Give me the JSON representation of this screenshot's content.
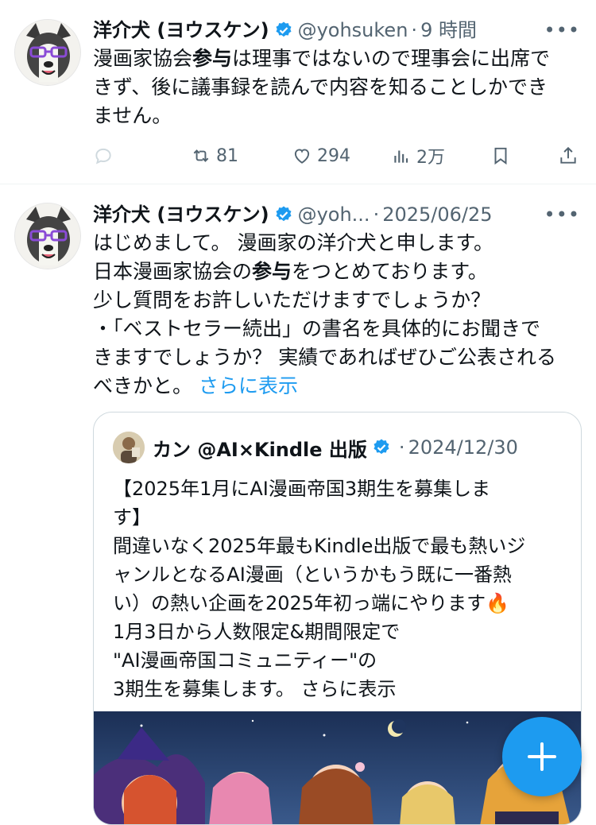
{
  "colors": {
    "accent": "#1d9bf0",
    "verified": "#1d9bf0",
    "muted": "#536471",
    "text": "#0f1419"
  },
  "tweets": [
    {
      "author_name": "洋介犬 (ヨウスケン)",
      "handle": "@yohsuken",
      "separator": "·",
      "time": "9 時間",
      "more": "•••",
      "body_lines": [
        {
          "pre": "漫画家協会",
          "bold": "参与",
          "post": "は理事ではないので理事会に出席で"
        },
        {
          "pre": "きず、後に議事録を読んで内容を知ることしかでき",
          "bold": "",
          "post": ""
        },
        {
          "pre": "ません。",
          "bold": "",
          "post": ""
        }
      ],
      "actions": {
        "reply_count": "",
        "retweet_count": "81",
        "like_count": "294",
        "view_count": "2万"
      }
    },
    {
      "author_name": "洋介犬 (ヨウスケン)",
      "handle": "@yoh...",
      "separator": "·",
      "time": "2025/06/25",
      "more": "•••",
      "body_lines": [
        {
          "pre": "はじめまして。 漫画家の洋介犬と申します。",
          "bold": "",
          "post": ""
        },
        {
          "pre": "日本漫画家協会の",
          "bold": "参与",
          "post": "をつとめております。"
        },
        {
          "pre": "少し質問をお許しいただけますでしょうか？",
          "bold": "",
          "post": ""
        },
        {
          "pre": "・「ベストセラー続出」の書名を具体的にお聞きで",
          "bold": "",
          "post": ""
        },
        {
          "pre": "きますでしょうか？ 実績であればぜひご公表される",
          "bold": "",
          "post": ""
        },
        {
          "pre": "べきかと。 ",
          "bold": "",
          "post": ""
        }
      ],
      "show_more": "さらに表示"
    }
  ],
  "quote": {
    "author_name": "カン @AI×Kindle 出版",
    "separator": "·",
    "time": "2024/12/30",
    "lines": [
      "【2025年1月にAI漫画帝国3期生を募集しま",
      "す】",
      "間違いなく2025年最もKindle出版で最も熱いジ",
      "ャンルとなるAI漫画（というかもう既に一番熱",
      "い）の熱い企画を2025年初っ端にやります🔥",
      "1月3日から人数限定&期間限定で",
      "\"AI漫画帝国コミュニティー\"の",
      "3期生を募集します。 "
    ],
    "show_more": "さらに表示"
  },
  "fab": {
    "label": "+"
  }
}
